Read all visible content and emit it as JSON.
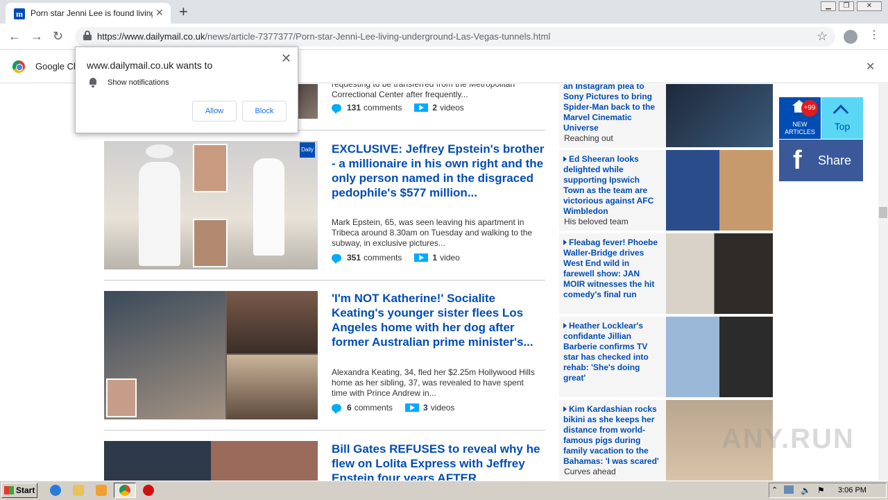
{
  "browser": {
    "tab_title": "Porn star Jenni Lee is found living in",
    "tab_favicon": "m",
    "new_tab": "+",
    "url_host": "https://www.dailymail.co.uk",
    "url_path": "/news/article-7377377/Porn-star-Jenni-Lee-living-underground-Las-Vegas-tunnels.html",
    "infobar_text": "Google Ch"
  },
  "popup": {
    "title": "www.dailymail.co.uk wants to",
    "permission": "Show notifications",
    "allow": "Allow",
    "block": "Block"
  },
  "articles": [
    {
      "desc": "requesting to be transferred from the Metropolitan Correctional Center after frequently...",
      "comments": "131",
      "comments_label": "comments",
      "videos": "2",
      "videos_label": "videos"
    },
    {
      "headline": "EXCLUSIVE: Jeffrey Epstein's brother - a millionaire in his own right and the only person named in the disgraced pedophile's $577 million...",
      "desc": "Mark Epstein, 65, was seen leaving his apartment in Tribeca around 8.30am on Tuesday and walking to the subway, in exclusive pictures...",
      "comments": "351",
      "comments_label": "comments",
      "videos": "1",
      "videos_label": "video"
    },
    {
      "headline": "'I'm NOT Katherine!' Socialite Keating's younger sister flees Los Angeles home with her dog after former Australian prime minister's...",
      "desc": "Alexandra Keating, 34, fled her $2.25m Hollywood Hills home as her sibling, 37, was revealed to have spent time with Prince Andrew in...",
      "comments": "6",
      "comments_label": "comments",
      "videos": "3",
      "videos_label": "videos"
    },
    {
      "headline": "Bill Gates REFUSES to reveal why he flew on Lolita Express with Jeffrey Epstein four years AFTER"
    }
  ],
  "sidebar": [
    {
      "title": "an Instagram plea to Sony Pictures to bring Spider-Man back to the Marvel Cinematic Universe",
      "sub": "Reaching out"
    },
    {
      "title": "Ed Sheeran looks delighted while supporting Ipswich Town as the team are victorious against AFC Wimbledon",
      "sub": "His beloved team"
    },
    {
      "title": "Fleabag fever! Phoebe Waller-Bridge drives West End wild in farewell show: JAN MOIR witnesses the hit comedy's final run",
      "sub": ""
    },
    {
      "title": "Heather Locklear's confidante Jillian Barberie confirms TV star has checked into rehab: 'She's doing great'",
      "sub": ""
    },
    {
      "title": "Kim Kardashian rocks bikini as she keeps her distance from world-famous pigs during family vacation to the Bahamas: 'I was scared'",
      "sub": "Curves ahead"
    }
  ],
  "floating": {
    "badge": "+99",
    "new_articles": "NEW ARTICLES",
    "top": "Top",
    "share": "Share",
    "fb": "f"
  },
  "taskbar": {
    "start": "Start",
    "time": "3:06 PM"
  },
  "watermark": "ANY.RUN",
  "colors": {
    "brand": "#004db3",
    "accent": "#00aaff",
    "facebook": "#3b5998",
    "top_button": "#5bd7f5"
  }
}
